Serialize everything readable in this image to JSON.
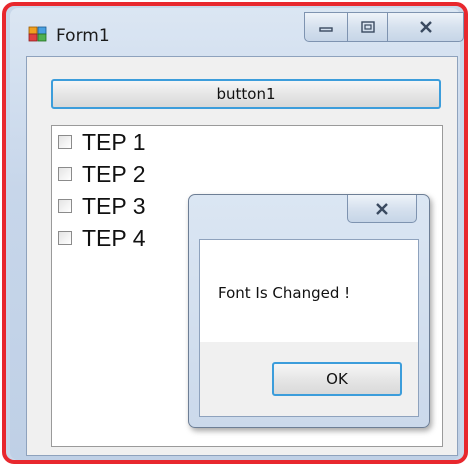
{
  "window": {
    "title": "Form1",
    "highlight_color": "#e8282e"
  },
  "caption_buttons": {
    "minimize_icon": "minimize-icon",
    "maximize_icon": "maximize-icon",
    "close_icon": "close-icon"
  },
  "main": {
    "button_label": "button1",
    "checklist": [
      {
        "label": "TEP 1",
        "checked": false
      },
      {
        "label": "TEP 2",
        "checked": false
      },
      {
        "label": "TEP 3",
        "checked": false
      },
      {
        "label": "TEP 4",
        "checked": false
      }
    ]
  },
  "message_box": {
    "text": "Font Is Changed !",
    "ok_label": "OK",
    "close_icon": "close-icon"
  }
}
